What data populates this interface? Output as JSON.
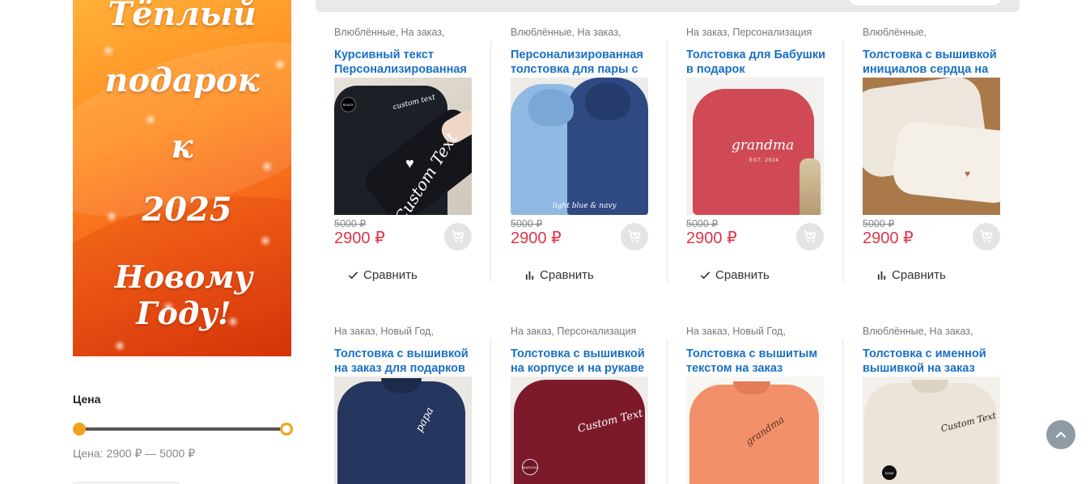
{
  "banner": {
    "lines": [
      "Тёплый",
      "подарок",
      "к",
      "2025",
      "Новому Году!"
    ]
  },
  "filter": {
    "title": "Цена",
    "range_text": "Цена: 2900 ₽ — 5000 ₽",
    "min": 2900,
    "max": 5000
  },
  "compare_label": "Сравнить",
  "products": [
    {
      "cats": [
        "Влюблённые",
        "На заказ",
        ""
      ],
      "title": "Курсивный текст Персонализированная",
      "old_price": "5000 ₽",
      "price": "2900 ₽",
      "compared": true
    },
    {
      "cats": [
        "Влюблённые",
        "На заказ",
        ""
      ],
      "title": "Персонализированная толстовка для пары с",
      "old_price": "5000 ₽",
      "price": "2900 ₽",
      "compared": false
    },
    {
      "cats": [
        "На заказ",
        "Персонализация"
      ],
      "title": "Толстовка для Бабушки в подарок",
      "old_price": "5000 ₽",
      "price": "2900 ₽",
      "compared": true
    },
    {
      "cats": [
        "Влюблённые",
        ""
      ],
      "title": "Толстовка с вышивкой инициалов сердца на",
      "old_price": "5000 ₽",
      "price": "2900 ₽",
      "compared": false
    },
    {
      "cats": [
        "На заказ",
        "Новый Год",
        ""
      ],
      "title": "Толстовка с вышивкой на заказ для подарков",
      "old_price": "",
      "price": "",
      "compared": false
    },
    {
      "cats": [
        "На заказ",
        "Персонализация"
      ],
      "title": "Толстовка с вышивкой на корпусе и на рукаве",
      "old_price": "",
      "price": "",
      "compared": false
    },
    {
      "cats": [
        "На заказ",
        "Новый Год",
        ""
      ],
      "title": "Толстовка с вышитым текстом на заказ",
      "old_price": "",
      "price": "",
      "compared": false
    },
    {
      "cats": [
        "Влюблённые",
        "На заказ",
        ""
      ],
      "title": "Толстовка с именной вышивкой на заказ",
      "old_price": "",
      "price": "",
      "compared": false
    }
  ],
  "image_text": {
    "p1_badge": "BLACK",
    "p1_sleeve": "Custom Text",
    "p1_chest": "custom text",
    "p2_caption": "light blue & navy",
    "p3_chest": "grandma",
    "p3_year": "EST. 2024",
    "p5_chest": "papa",
    "p6_chest": "Custom Text",
    "p6_badge": "MAROON",
    "p7_chest": "grandma",
    "p8_chest": "Custom Text",
    "p8_badge": "SAND"
  },
  "colors": {
    "link": "#1a6fc4",
    "price": "#e0334b",
    "accent": "#f1a21c"
  },
  "icons": {
    "cart": "add-to-cart-icon",
    "compare_done": "check-icon",
    "compare": "bar-chart-icon",
    "back_to_top": "chevron-up-icon"
  }
}
